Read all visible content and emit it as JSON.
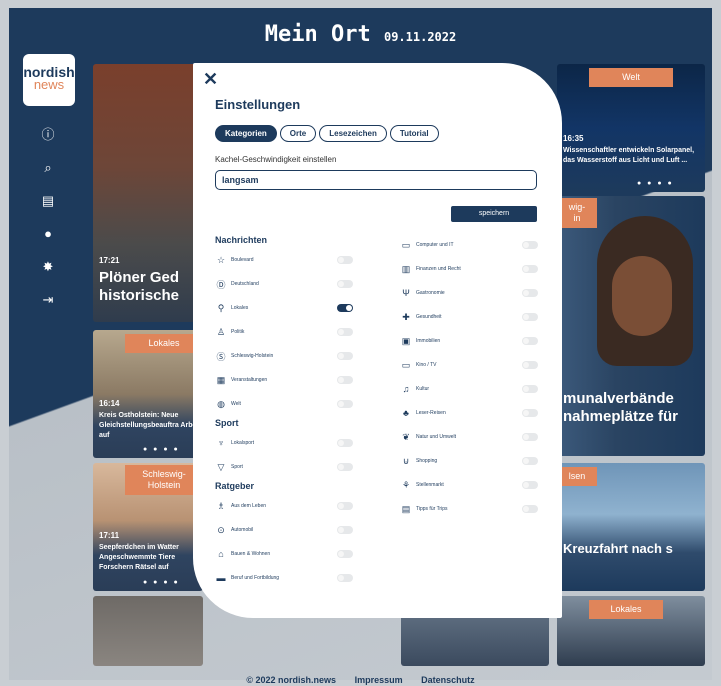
{
  "header": {
    "title": "Mein Ort",
    "date": "09.11.2022"
  },
  "logo": {
    "line1": "nordish",
    "line2": "news"
  },
  "sidebar": {
    "icons": [
      "info-icon",
      "search-icon",
      "archive-icon",
      "user-icon",
      "gear-icon",
      "logout-icon"
    ]
  },
  "tiles": {
    "top_right": {
      "badge": "Welt",
      "time": "16:35",
      "text": "Wissenschaftler entwickeln Solarpanel, das Wasserstoff aus Licht und Luft ..."
    },
    "big_left": {
      "time": "17:21",
      "title": "Plöner Ged historische"
    },
    "mid_left": {
      "badge": "Lokales",
      "time": "16:14",
      "text": "Kreis Ostholstein: Neue Gleichstellungsbeauftra Arbeit auf"
    },
    "lower_left": {
      "badge": "Schleswig-Holstein",
      "time": "17:11",
      "text": "Seepferdchen im Watter Angeschwemmte Tiere Forschern Rätsel auf"
    },
    "right_big": {
      "badge": "wig-",
      "badge2": "in",
      "title": "munalverbände nahmeplätze für"
    },
    "right_lower": {
      "badge": "lsen",
      "title": "Kreuzfahrt nach s"
    },
    "bottom_right": {
      "badge": "Lokales"
    }
  },
  "modal": {
    "title": "Einstellungen",
    "tabs": [
      "Kategorien",
      "Orte",
      "Lesezeichen",
      "Tutorial"
    ],
    "speed_label": "Kachel-Geschwindigkeit einstellen",
    "speed_value": "langsam",
    "save_label": "speichern",
    "left_sections": [
      {
        "title": "Nachrichten",
        "items": [
          {
            "label": "Boulevard",
            "icon": "star-icon",
            "glyph": "☆",
            "on": false
          },
          {
            "label": "Deutschland",
            "icon": "coin-icon",
            "glyph": "Ⓓ",
            "on": false
          },
          {
            "label": "Lokales",
            "icon": "pin-icon",
            "glyph": "⚲",
            "on": true
          },
          {
            "label": "Politik",
            "icon": "podium-icon",
            "glyph": "♙",
            "on": false
          },
          {
            "label": "Schleswig-Holstein",
            "icon": "sh-icon",
            "glyph": "Ⓢ",
            "on": false
          },
          {
            "label": "Veranstaltungen",
            "icon": "calendar-icon",
            "glyph": "▦",
            "on": false
          },
          {
            "label": "Welt",
            "icon": "globe-icon",
            "glyph": "◍",
            "on": false
          }
        ]
      },
      {
        "title": "Sport",
        "items": [
          {
            "label": "Lokalsport",
            "icon": "trophy-icon",
            "glyph": "♆",
            "on": false
          },
          {
            "label": "Sport",
            "icon": "cup-icon",
            "glyph": "▽",
            "on": false
          }
        ]
      },
      {
        "title": "Ratgeber",
        "items": [
          {
            "label": "Aus dem Leben",
            "icon": "people-icon",
            "glyph": "♗",
            "on": false
          },
          {
            "label": "Automobil",
            "icon": "wheel-icon",
            "glyph": "⊙",
            "on": false
          },
          {
            "label": "Bauen & Wohnen",
            "icon": "house-icon",
            "glyph": "⌂",
            "on": false
          },
          {
            "label": "Beruf und Fortbildung",
            "icon": "briefcase-icon",
            "glyph": "▬",
            "on": false
          }
        ]
      }
    ],
    "right_items": [
      {
        "label": "Computer und IT",
        "icon": "monitor-icon",
        "glyph": "▭",
        "on": false
      },
      {
        "label": "Finanzen und Recht",
        "icon": "finance-icon",
        "glyph": "▥",
        "on": false
      },
      {
        "label": "Gastronomie",
        "icon": "cutlery-icon",
        "glyph": "Ψ",
        "on": false
      },
      {
        "label": "Gesundheit",
        "icon": "cross-icon",
        "glyph": "✚",
        "on": false
      },
      {
        "label": "Immobilien",
        "icon": "building-icon",
        "glyph": "▣",
        "on": false
      },
      {
        "label": "Kino / TV",
        "icon": "tv-icon",
        "glyph": "▭",
        "on": false
      },
      {
        "label": "Kultur",
        "icon": "culture-icon",
        "glyph": "♫",
        "on": false
      },
      {
        "label": "Leser-Reisen",
        "icon": "palm-icon",
        "glyph": "♣",
        "on": false
      },
      {
        "label": "Natur und Umwelt",
        "icon": "leaf-icon",
        "glyph": "❦",
        "on": false
      },
      {
        "label": "Shopping",
        "icon": "cart-icon",
        "glyph": "⊍",
        "on": false
      },
      {
        "label": "Stellenmarkt",
        "icon": "handshake-icon",
        "glyph": "⚘",
        "on": false
      },
      {
        "label": "Tipps für Trips",
        "icon": "suitcase-icon",
        "glyph": "▤",
        "on": false
      }
    ]
  },
  "footer": {
    "copyright": "© 2022 nordish.news",
    "impressum": "Impressum",
    "datenschutz": "Datenschutz"
  }
}
